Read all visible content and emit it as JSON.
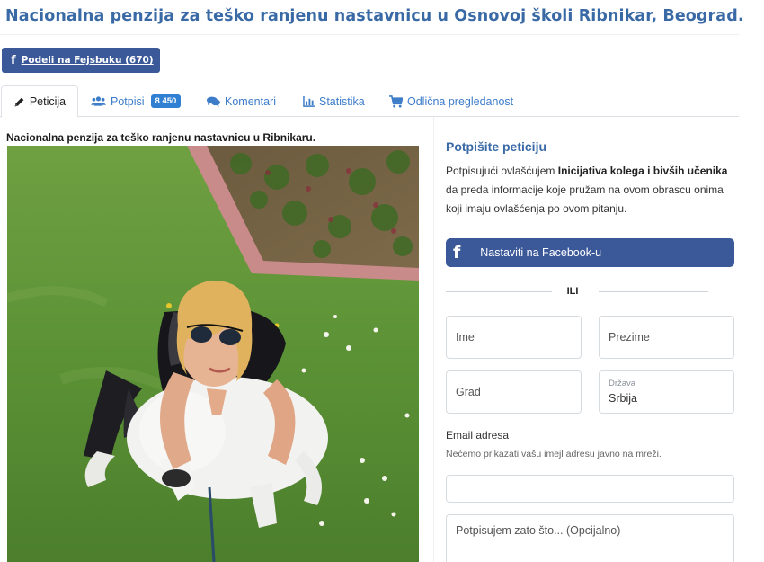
{
  "page": {
    "title": "Nacionalna penzija za teško ranjenu nastavnicu u Osnovoj školi Ribnikar, Beograd."
  },
  "share": {
    "label": "Podeli na Fejsbuku (670)",
    "icon": "facebook-icon"
  },
  "tabs": [
    {
      "label": "Peticija",
      "icon": "pencil-icon",
      "active": true
    },
    {
      "label": "Potpisi",
      "icon": "users-icon",
      "badge": "8 450"
    },
    {
      "label": "Komentari",
      "icon": "comments-icon"
    },
    {
      "label": "Statistika",
      "icon": "bar-chart-icon"
    },
    {
      "label": "Odlična pregledanost",
      "icon": "cart-icon"
    }
  ],
  "petition": {
    "image_caption": "Nacionalna penzija za teško ranjenu nastavnicu u Ribnikaru."
  },
  "sign_form": {
    "title": "Potpišite peticiju",
    "consent_prefix": "Potpisujući ovlašćujem ",
    "consent_org": "Inicijativa kolega i bivših učenika",
    "consent_suffix": " da preda informacije koje pružam na ovom obrascu onima koji imaju ovlašćenja po ovom pitanju.",
    "facebook_button": "Nastaviti na Facebook-u",
    "or_label": "ILI",
    "first_name_placeholder": "Ime",
    "last_name_placeholder": "Prezime",
    "city_placeholder": "Grad",
    "country_label": "Država",
    "country_value": "Srbija",
    "email_label": "Email adresa",
    "email_hint": "Nećemo prikazati vašu imejl adresu javno na mreži.",
    "reason_placeholder": "Potpisujem zato što... (Opcijalno)"
  },
  "colors": {
    "facebook_blue": "#3b5998",
    "link_blue": "#3d7cc9",
    "title_blue": "#3a6aa6",
    "badge_blue": "#2f7fd3"
  }
}
